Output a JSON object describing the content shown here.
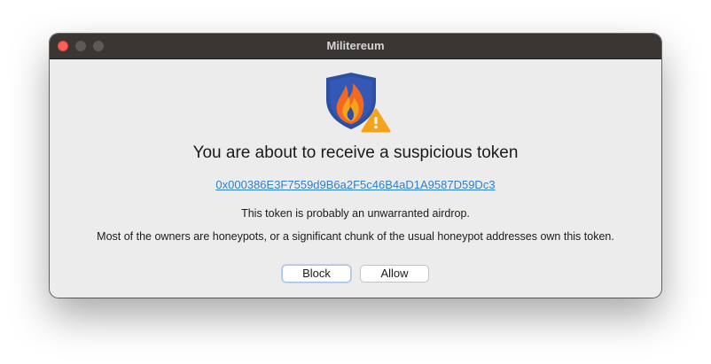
{
  "window": {
    "title": "Militereum"
  },
  "dialog": {
    "heading": "You are about to receive a suspicious token",
    "token_address": "0x000386E3F7559d9B6a2F5c46B4aD1A9587D59Dc3",
    "line1": "This token is probably an unwarranted airdrop.",
    "line2": "Most of the owners are honeypots, or a significant chunk of the usual honeypot addresses own this token."
  },
  "buttons": {
    "block_label": "Block",
    "allow_label": "Allow"
  },
  "icons": {
    "app_logo": "flame-shield-icon",
    "warning": "warning-triangle-icon"
  },
  "colors": {
    "link": "#2b7fd4",
    "shield": "#2a4fa3",
    "flame": "#f26a21",
    "warning": "#f7a21b"
  }
}
